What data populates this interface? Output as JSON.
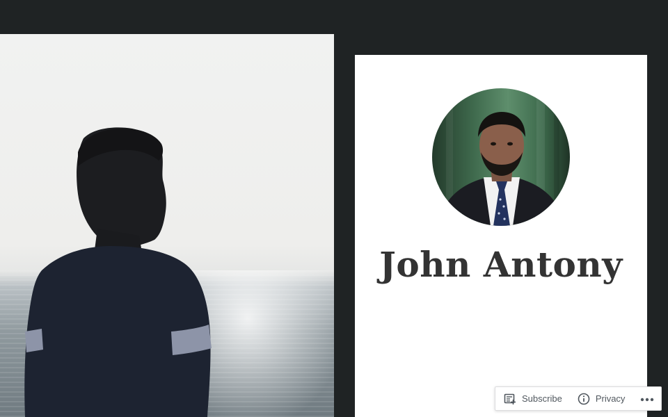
{
  "profile": {
    "name": "John Antony"
  },
  "hero": {
    "image": "silhouette-by-sea-photo"
  },
  "action_bar": {
    "subscribe_label": "Subscribe",
    "privacy_label": "Privacy",
    "subscribe_icon": "reader-icon",
    "privacy_icon": "info-icon",
    "more_icon": "ellipsis-icon"
  },
  "colors": {
    "background": "#1f2324",
    "card": "#ffffff",
    "name_text": "#333333",
    "action_text": "#50575e"
  }
}
